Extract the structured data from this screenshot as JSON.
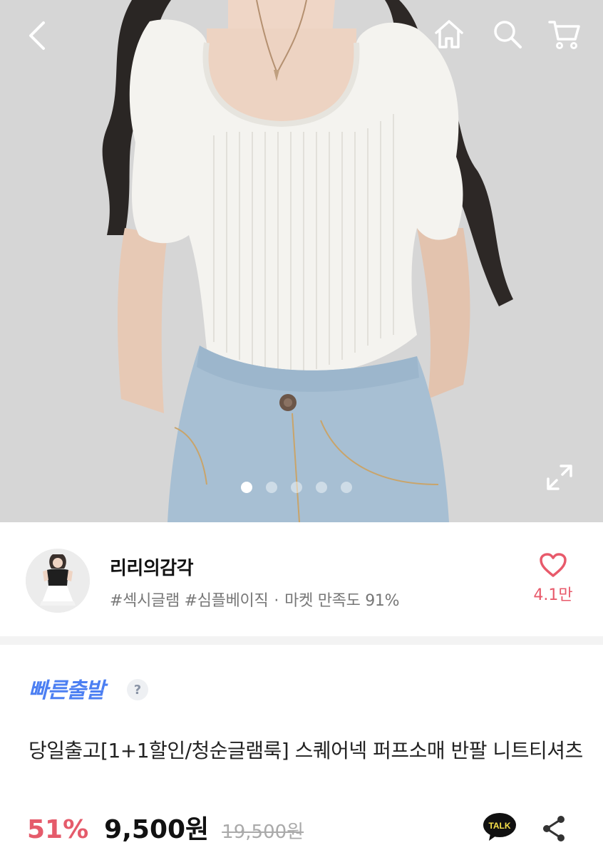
{
  "header": {
    "back_icon": "chevron-left-icon",
    "home_icon": "home-icon",
    "search_icon": "search-icon",
    "cart_icon": "cart-icon"
  },
  "gallery": {
    "total_slides": 5,
    "active_slide": 1,
    "expand_icon": "expand-icon"
  },
  "shop": {
    "name": "리리의감각",
    "tags": "#섹시글램 #심플베이직",
    "separator": "·",
    "satisfaction": "마켓 만족도 91%",
    "like_count": "4.1만"
  },
  "product": {
    "badge": "빠른출발",
    "help": "?",
    "title": "당일출고[1+1할인/청순글램룩] 스퀘어넥 퍼프소매 반팔 니트티셔츠",
    "discount": "51%",
    "price": "9,500원",
    "original_price": "19,500원",
    "talk_label": "TALK"
  },
  "colors": {
    "accent_pink": "#e55b6b",
    "accent_blue": "#4c7ff2"
  }
}
